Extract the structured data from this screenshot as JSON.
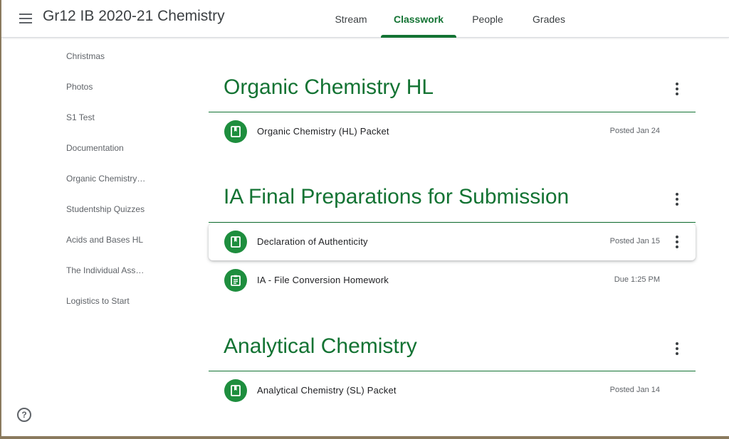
{
  "header": {
    "class_title": "Gr12 IB 2020-21 Chemistry",
    "tabs": [
      {
        "label": "Stream"
      },
      {
        "label": "Classwork",
        "active": true
      },
      {
        "label": "People"
      },
      {
        "label": "Grades"
      }
    ]
  },
  "sidebar": {
    "topics": [
      "Christmas",
      "Photos",
      "S1 Test",
      "Documentation",
      "Organic Chemistry (HL)",
      "Studentship Quizzes",
      "Acids and Bases HL",
      "The Individual Assessment",
      "Logistics to Start"
    ],
    "help_label": "?"
  },
  "topics": [
    {
      "title": "Organic Chemistry HL",
      "items": [
        {
          "title": "Organic Chemistry (HL) Packet",
          "meta": "Posted Jan 24",
          "icon": "material-icon"
        }
      ]
    },
    {
      "title": "IA Final Preparations for Submission",
      "items": [
        {
          "title": "Declaration of Authenticity",
          "meta": "Posted Jan 15",
          "icon": "material-icon"
        },
        {
          "title": "IA - File Conversion Homework",
          "meta": "Due 1:25 PM",
          "icon": "assignment-icon"
        }
      ]
    },
    {
      "title": "Analytical Chemistry",
      "items": [
        {
          "title": "Analytical Chemistry (SL) Packet",
          "meta": "Posted Jan 14",
          "icon": "material-icon"
        }
      ]
    }
  ],
  "colors": {
    "accent": "#137333",
    "icon_bg": "#1e8e3e"
  }
}
